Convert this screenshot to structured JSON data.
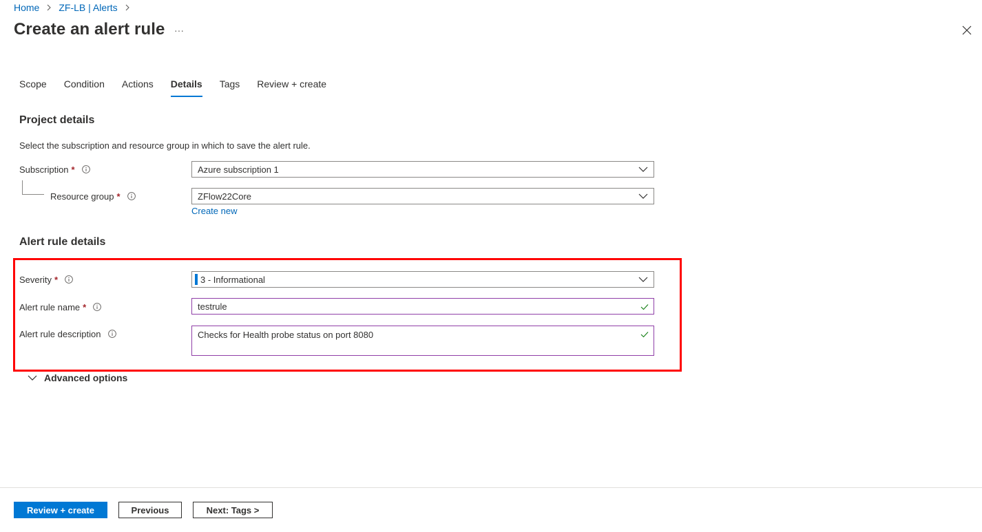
{
  "breadcrumb": {
    "home": "Home",
    "parent": "ZF-LB | Alerts"
  },
  "header": {
    "title": "Create an alert rule",
    "more": "···"
  },
  "tabs": [
    {
      "label": "Scope"
    },
    {
      "label": "Condition"
    },
    {
      "label": "Actions"
    },
    {
      "label": "Details",
      "active": true
    },
    {
      "label": "Tags"
    },
    {
      "label": "Review + create"
    }
  ],
  "project": {
    "heading": "Project details",
    "description": "Select the subscription and resource group in which to save the alert rule.",
    "subscription_label": "Subscription",
    "subscription_value": "Azure subscription 1",
    "resource_group_label": "Resource group",
    "resource_group_value": "ZFlow22Core",
    "create_new": "Create new"
  },
  "alert": {
    "heading": "Alert rule details",
    "severity_label": "Severity",
    "severity_value": "3 - Informational",
    "name_label": "Alert rule name",
    "name_value": "testrule",
    "description_label": "Alert rule description",
    "description_value": "Checks for Health probe status on port 8080",
    "advanced": "Advanced options"
  },
  "required_marker": "*",
  "footer": {
    "review_create": "Review + create",
    "previous": "Previous",
    "next": "Next: Tags >"
  },
  "colors": {
    "accent": "#0078d4",
    "link": "#0067b8",
    "required": "#a4262c",
    "valid_border": "#8f3ea7",
    "valid_check": "#107c10",
    "highlight": "#ff0000"
  },
  "icons": {
    "close": "close-icon",
    "info": "info-icon",
    "chevron": "chevron-down-icon",
    "check": "checkmark-icon",
    "breadcrumb_sep": "chevron-right-icon"
  }
}
